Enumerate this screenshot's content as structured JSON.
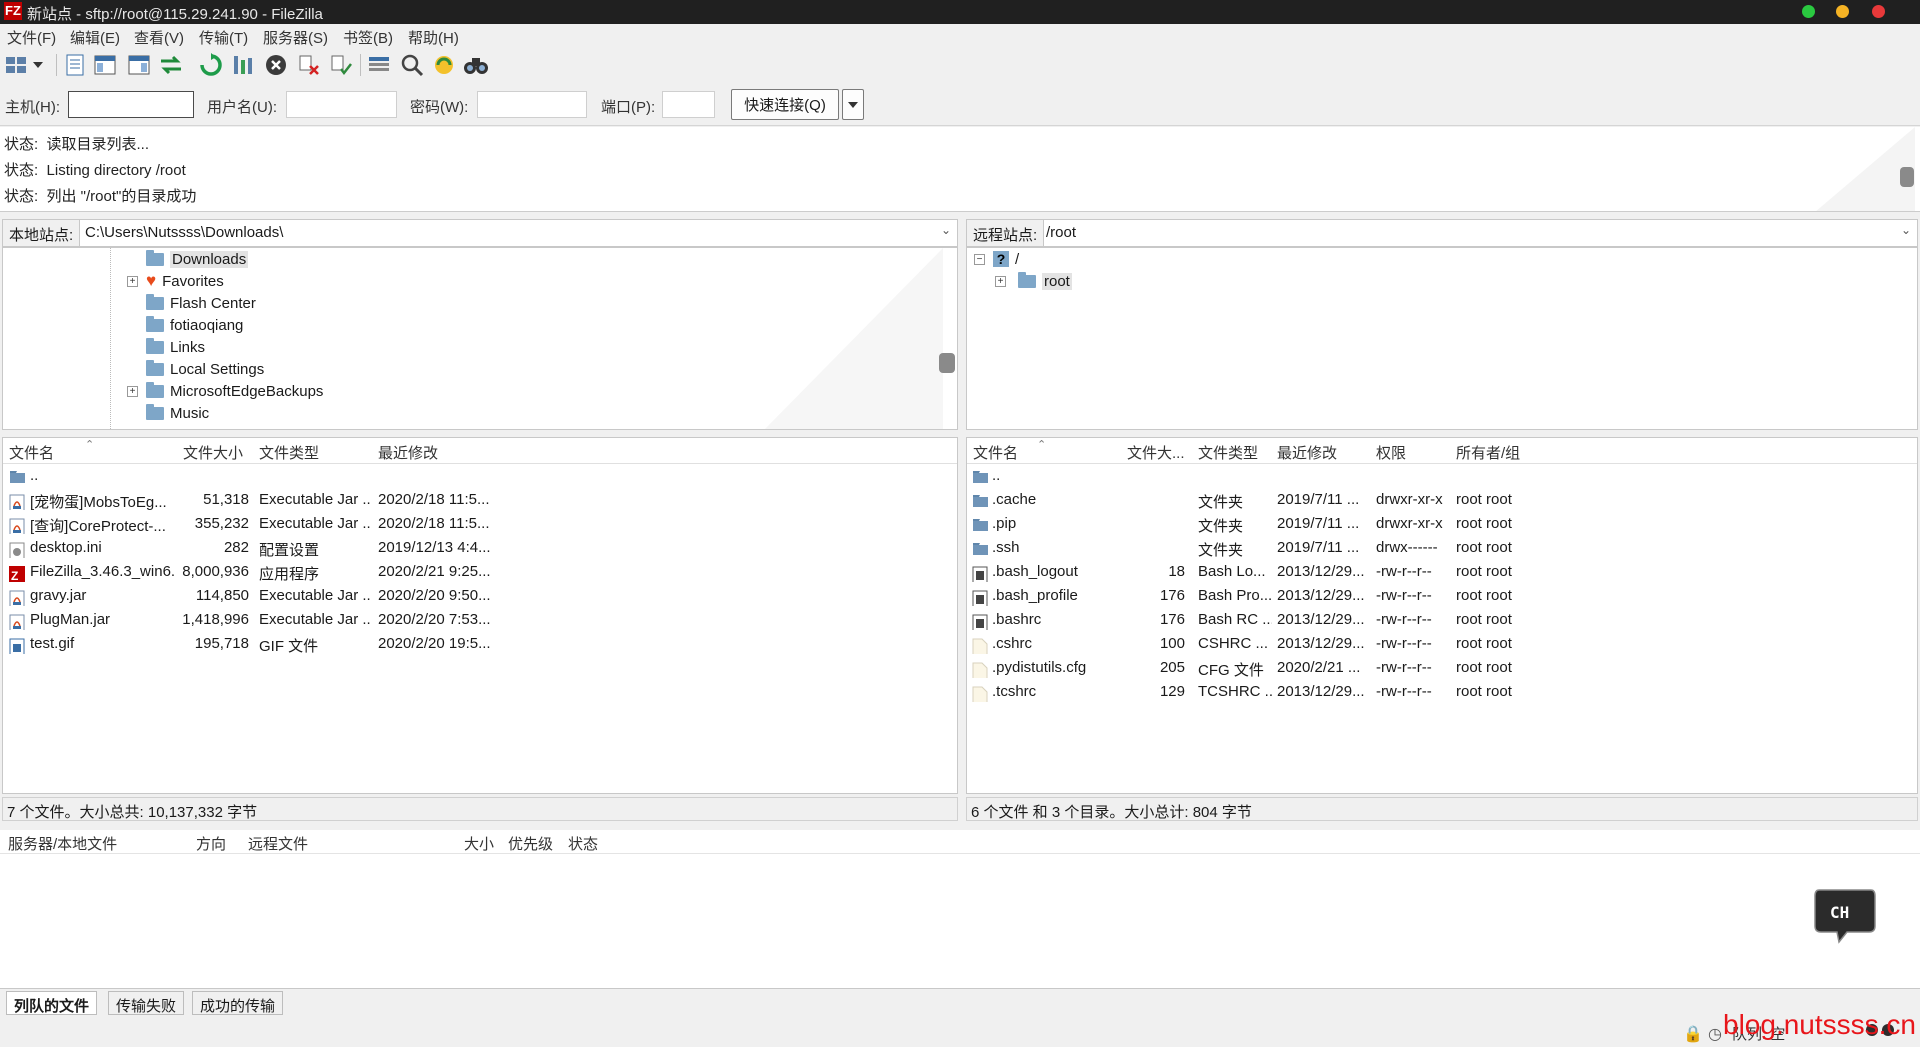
{
  "window": {
    "title": "新站点 - sftp://root@115.29.241.90 - FileZilla",
    "app_logo": "FZ"
  },
  "menubar": {
    "items": [
      "文件(F)",
      "编辑(E)",
      "查看(V)",
      "传输(T)",
      "服务器(S)",
      "书签(B)",
      "帮助(H)"
    ]
  },
  "quickconnect": {
    "host_label": "主机(H):",
    "host_value": "",
    "user_label": "用户名(U):",
    "user_value": "",
    "pass_label": "密码(W):",
    "pass_value": "",
    "port_label": "端口(P):",
    "port_value": "",
    "connect_button": "快速连接(Q)"
  },
  "log": [
    {
      "label": "状态:",
      "text": "读取目录列表..."
    },
    {
      "label": "状态:",
      "text": "Listing directory /root"
    },
    {
      "label": "状态:",
      "text": "列出 \"/root\"的目录成功"
    }
  ],
  "local": {
    "label": "本地站点:",
    "path": "C:\\Users\\Nutssss\\Downloads\\",
    "tree": [
      {
        "name": "Downloads",
        "icon": "folder-icon",
        "expandable": false,
        "selected": true
      },
      {
        "name": "Favorites",
        "icon": "heart-icon",
        "expandable": true
      },
      {
        "name": "Flash Center",
        "icon": "folder-icon",
        "expandable": false
      },
      {
        "name": "fotiaoqiang",
        "icon": "folder-icon",
        "expandable": false
      },
      {
        "name": "Links",
        "icon": "folder-icon",
        "expandable": false
      },
      {
        "name": "Local Settings",
        "icon": "folder-icon",
        "expandable": false
      },
      {
        "name": "MicrosoftEdgeBackups",
        "icon": "folder-icon",
        "expandable": true
      },
      {
        "name": "Music",
        "icon": "folder-icon",
        "expandable": false
      }
    ],
    "columns": [
      "文件名",
      "文件大小",
      "文件类型",
      "最近修改"
    ],
    "files": [
      {
        "name": "..",
        "size": "",
        "type": "",
        "modified": "",
        "icon": "folder-icon"
      },
      {
        "name": "[宠物蛋]MobsToEg...",
        "size": "51,318",
        "type": "Executable Jar ...",
        "modified": "2020/2/18 11:5...",
        "icon": "jar-icon"
      },
      {
        "name": "[查询]CoreProtect-...",
        "size": "355,232",
        "type": "Executable Jar ...",
        "modified": "2020/2/18 11:5...",
        "icon": "jar-icon"
      },
      {
        "name": "desktop.ini",
        "size": "282",
        "type": "配置设置",
        "modified": "2019/12/13 4:4...",
        "icon": "ini-icon"
      },
      {
        "name": "FileZilla_3.46.3_win6...",
        "size": "8,000,936",
        "type": "应用程序",
        "modified": "2020/2/21 9:25...",
        "icon": "filezilla-icon"
      },
      {
        "name": "gravy.jar",
        "size": "114,850",
        "type": "Executable Jar ...",
        "modified": "2020/2/20 9:50...",
        "icon": "jar-icon"
      },
      {
        "name": "PlugMan.jar",
        "size": "1,418,996",
        "type": "Executable Jar ...",
        "modified": "2020/2/20 7:53...",
        "icon": "jar-icon"
      },
      {
        "name": "test.gif",
        "size": "195,718",
        "type": "GIF 文件",
        "modified": "2020/2/20 19:5...",
        "icon": "gif-icon"
      }
    ],
    "status": "7 个文件。大小总共: 10,137,332 字节"
  },
  "remote": {
    "label": "远程站点:",
    "path": "/root",
    "tree": [
      {
        "name": "/",
        "icon": "unknown-folder-icon",
        "expandable": true,
        "expanded": true
      },
      {
        "name": "root",
        "icon": "folder-icon",
        "expandable": true,
        "selected": true
      }
    ],
    "columns": [
      "文件名",
      "文件大...",
      "文件类型",
      "最近修改",
      "权限",
      "所有者/组"
    ],
    "files": [
      {
        "name": "..",
        "size": "",
        "type": "",
        "modified": "",
        "perm": "",
        "owner": "",
        "icon": "folder-icon"
      },
      {
        "name": ".cache",
        "size": "",
        "type": "文件夹",
        "modified": "2019/7/11 ...",
        "perm": "drwxr-xr-x",
        "owner": "root root",
        "icon": "folder-icon"
      },
      {
        "name": ".pip",
        "size": "",
        "type": "文件夹",
        "modified": "2019/7/11 ...",
        "perm": "drwxr-xr-x",
        "owner": "root root",
        "icon": "folder-icon"
      },
      {
        "name": ".ssh",
        "size": "",
        "type": "文件夹",
        "modified": "2019/7/11 ...",
        "perm": "drwx------",
        "owner": "root root",
        "icon": "folder-icon"
      },
      {
        "name": ".bash_logout",
        "size": "18",
        "type": "Bash Lo...",
        "modified": "2013/12/29...",
        "perm": "-rw-r--r--",
        "owner": "root root",
        "icon": "file-icon"
      },
      {
        "name": ".bash_profile",
        "size": "176",
        "type": "Bash Pro...",
        "modified": "2013/12/29...",
        "perm": "-rw-r--r--",
        "owner": "root root",
        "icon": "file-icon"
      },
      {
        "name": ".bashrc",
        "size": "176",
        "type": "Bash RC ...",
        "modified": "2013/12/29...",
        "perm": "-rw-r--r--",
        "owner": "root root",
        "icon": "file-icon"
      },
      {
        "name": ".cshrc",
        "size": "100",
        "type": "CSHRC ...",
        "modified": "2013/12/29...",
        "perm": "-rw-r--r--",
        "owner": "root root",
        "icon": "blank-file-icon"
      },
      {
        "name": ".pydistutils.cfg",
        "size": "205",
        "type": "CFG 文件",
        "modified": "2020/2/21 ...",
        "perm": "-rw-r--r--",
        "owner": "root root",
        "icon": "blank-file-icon"
      },
      {
        "name": ".tcshrc",
        "size": "129",
        "type": "TCSHRC ...",
        "modified": "2013/12/29...",
        "perm": "-rw-r--r--",
        "owner": "root root",
        "icon": "blank-file-icon"
      }
    ],
    "status": "6 个文件 和 3 个目录。大小总计: 804 字节"
  },
  "queue": {
    "columns": [
      "服务器/本地文件",
      "方向",
      "远程文件",
      "大小",
      "优先级",
      "状态"
    ],
    "tabs": [
      "列队的文件",
      "传输失败",
      "成功的传输"
    ],
    "status_text": "队列: 空"
  },
  "ime": {
    "label": "CH"
  },
  "watermark": "blog.nutssss.cn",
  "colors": {
    "titlebar": "#202020",
    "accent_red": "#bf0000",
    "folder": "#7ea6c8",
    "watermark": "#e8161b"
  }
}
